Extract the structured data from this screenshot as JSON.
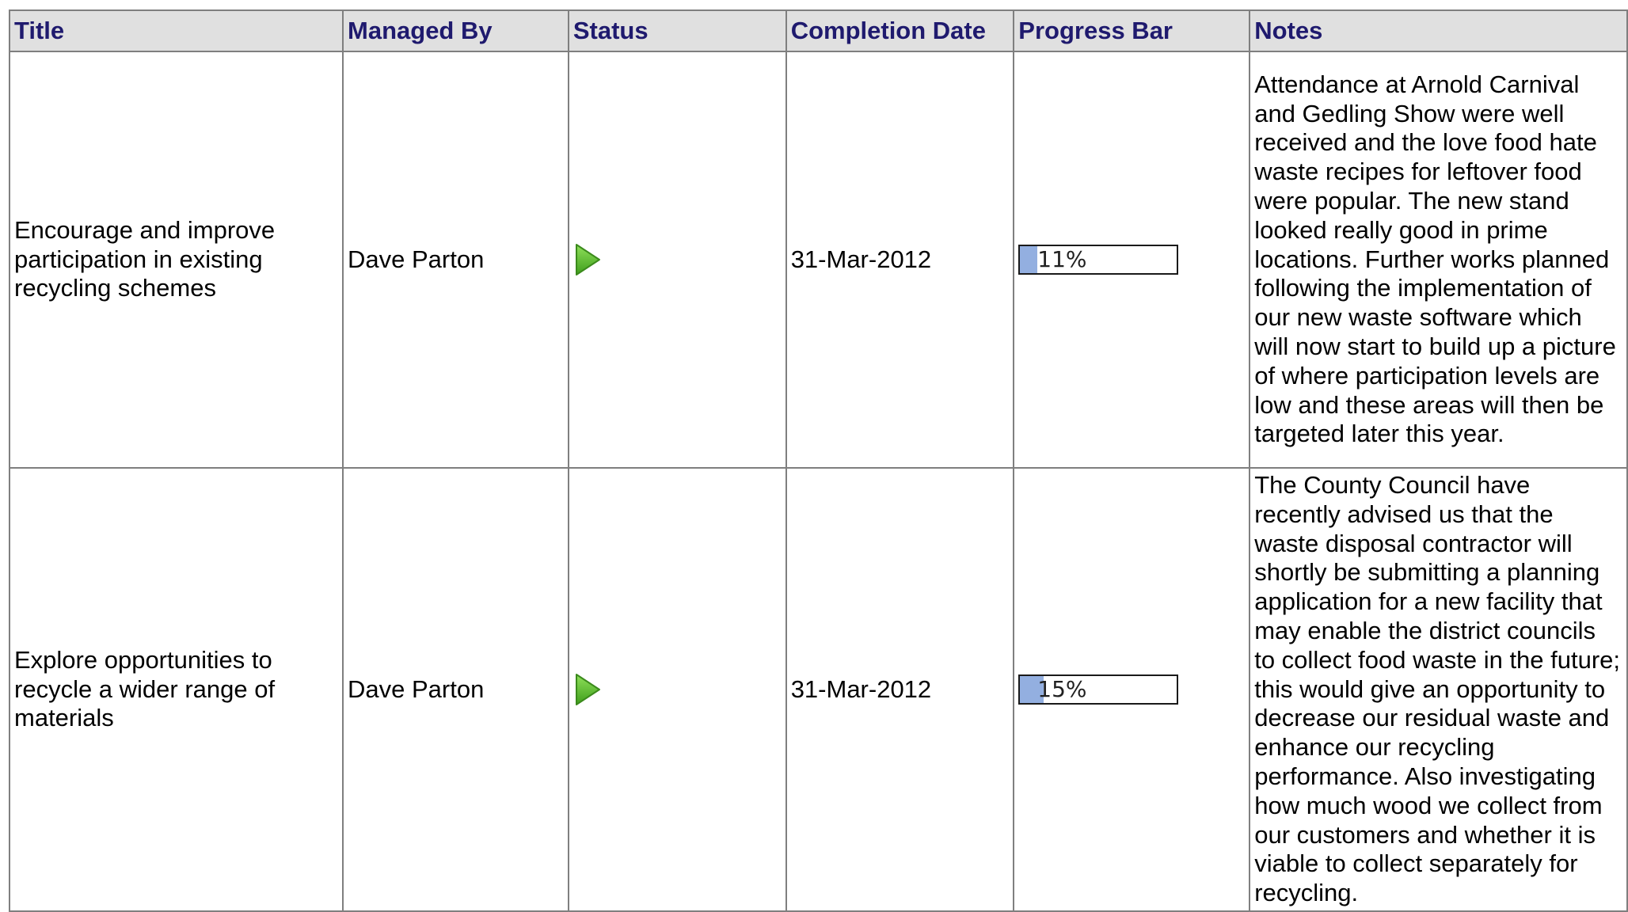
{
  "colors": {
    "header_text": "#1f1a6e",
    "header_bg": "#e0e0e0",
    "grid": "#7f7f7f",
    "progress_fill": "#93afe0",
    "status_icon": "#5cc02c"
  },
  "table": {
    "headers": {
      "title": "Title",
      "managed_by": "Managed By",
      "status": "Status",
      "completion_date": "Completion Date",
      "progress_bar": "Progress Bar",
      "notes": "Notes"
    },
    "rows": [
      {
        "title": "Encourage and improve participation in existing recycling schemes",
        "managed_by": "Dave Parton",
        "status_icon": "green-play-arrow-icon",
        "completion_date": "31-Mar-2012",
        "progress_percent": 11,
        "progress_label": "11%",
        "notes": "Attendance at Arnold Carnival and Gedling Show were well received and the love food hate waste recipes for leftover food were popular. The new stand looked really good in prime locations. Further works planned following the implementation of our new waste software which will now start to build up a picture of where participation levels are low and these areas will then be targeted later this year."
      },
      {
        "title": "Explore opportunities to recycle a wider range of materials",
        "managed_by": "Dave Parton",
        "status_icon": "green-play-arrow-icon",
        "completion_date": "31-Mar-2012",
        "progress_percent": 15,
        "progress_label": "15%",
        "notes": "The County Council have recently advised us that the waste disposal contractor will shortly be submitting a planning application for a new facility that may enable the district councils to collect food waste in the future; this would give an opportunity to decrease our residual waste and enhance our recycling performance. Also investigating how much wood we collect from our customers and whether it is viable to collect separately for recycling."
      }
    ]
  }
}
